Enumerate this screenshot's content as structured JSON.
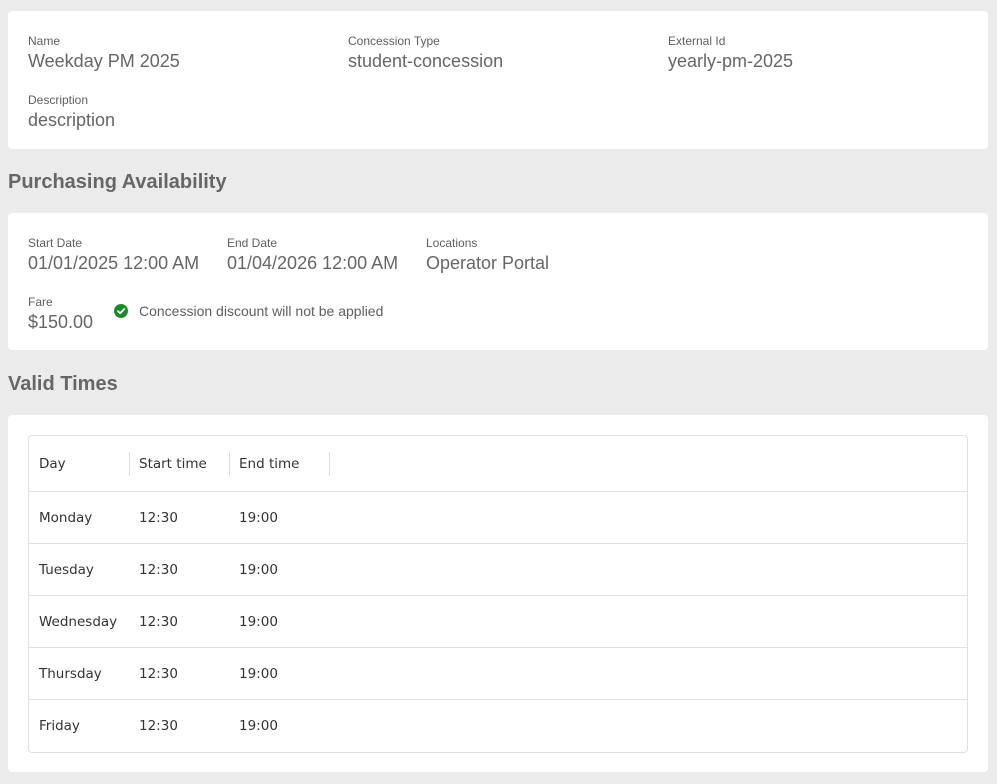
{
  "details": {
    "name": {
      "label": "Name",
      "value": "Weekday PM 2025"
    },
    "concession_type": {
      "label": "Concession Type",
      "value": "student-concession"
    },
    "external_id": {
      "label": "External Id",
      "value": "yearly-pm-2025"
    },
    "description": {
      "label": "Description",
      "value": "description"
    }
  },
  "purchasing": {
    "title": "Purchasing Availability",
    "start_date": {
      "label": "Start Date",
      "value": "01/01/2025 12:00 AM"
    },
    "end_date": {
      "label": "End Date",
      "value": "01/04/2026 12:00 AM"
    },
    "locations": {
      "label": "Locations",
      "value": "Operator Portal"
    },
    "fare": {
      "label": "Fare",
      "value": "$150.00"
    },
    "discount_note": "Concession discount will not be applied",
    "discount_icon": "check-circle-icon",
    "status_color": "#1e8a2e"
  },
  "valid_times": {
    "title": "Valid Times",
    "columns": [
      "Day",
      "Start time",
      "End time"
    ],
    "rows": [
      [
        "Monday",
        "12:30",
        "19:00"
      ],
      [
        "Tuesday",
        "12:30",
        "19:00"
      ],
      [
        "Wednesday",
        "12:30",
        "19:00"
      ],
      [
        "Thursday",
        "12:30",
        "19:00"
      ],
      [
        "Friday",
        "12:30",
        "19:00"
      ]
    ]
  }
}
